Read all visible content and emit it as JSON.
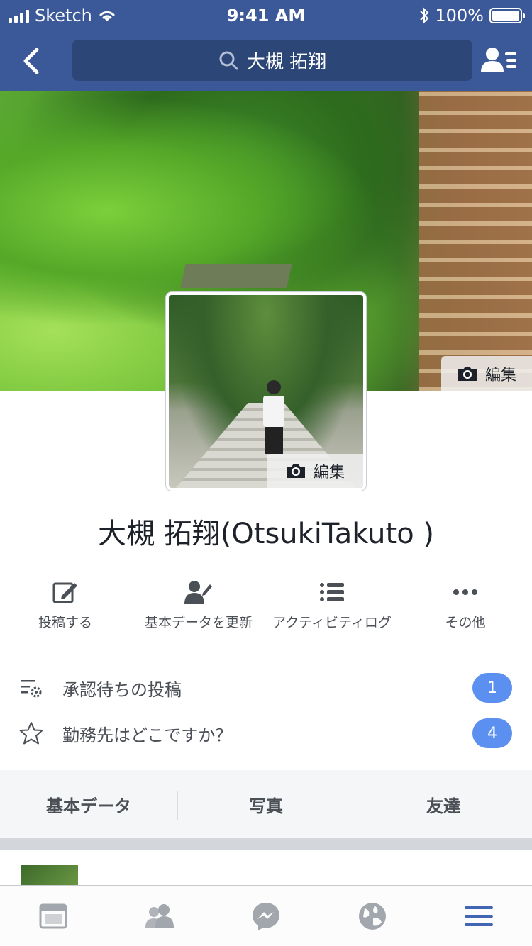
{
  "status_bar": {
    "carrier": "Sketch",
    "time": "9:41 AM",
    "battery": "100%",
    "battery_level": 1.0
  },
  "nav": {
    "search_text": "大槻 拓翔"
  },
  "cover": {
    "edit_label": "編集"
  },
  "profile": {
    "edit_label": "編集",
    "name": "大槻 拓翔(OtsukiTakuto )"
  },
  "actions": [
    {
      "label": "投稿する",
      "icon": "edit-icon"
    },
    {
      "label": "基本データを更新",
      "icon": "person-edit-icon"
    },
    {
      "label": "アクティビティログ",
      "icon": "list-icon"
    },
    {
      "label": "その他",
      "icon": "more-icon"
    }
  ],
  "prompts": [
    {
      "label": "承認待ちの投稿",
      "count": "1",
      "icon": "settings-list-icon"
    },
    {
      "label": "勤務先はどこですか？",
      "count": "4",
      "icon": "star-icon"
    }
  ],
  "tabs": [
    "基本データ",
    "写真",
    "友達"
  ],
  "tab_bar": {
    "items": [
      "news-feed-icon",
      "friends-icon",
      "messenger-icon",
      "globe-icon",
      "menu-icon"
    ],
    "active_color": "#4267b2",
    "inactive_color": "#a2a6ad"
  },
  "colors": {
    "brand": "#3b5998",
    "badge": "#5b8ff0"
  }
}
